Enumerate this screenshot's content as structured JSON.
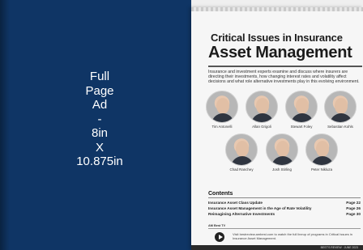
{
  "ad": {
    "lines": [
      "Full",
      "Page",
      "Ad",
      "-",
      "8in",
      "X",
      "10.875in"
    ]
  },
  "cover": {
    "title_line1": "Critical Issues in Insurance",
    "title_line2": "Asset Management",
    "intro": "Insurance and investment experts examine and discuss where insurers are directing their investments, how changing interest rates and volatility affect decisions and what role alternative investments play in this evolving environment.",
    "panelists": [
      {
        "name": "Tim Antonelli"
      },
      {
        "name": "Allan Grigoli"
      },
      {
        "name": "Stewart Foley"
      },
      {
        "name": "Sebastian Kohls"
      },
      {
        "name": "Chad Ranchey"
      },
      {
        "name": "Josh Stirling"
      },
      {
        "name": "Peter Nikluza"
      }
    ],
    "contents": {
      "heading": "Contents",
      "items": [
        {
          "title": "Insurance Asset Class Update",
          "page": "Page 22"
        },
        {
          "title": "Insurance Asset Management in the Age of Rate Volatility",
          "page": "Page 26"
        },
        {
          "title": "Reimagining Alternative Investments",
          "page": "Page 30"
        }
      ]
    },
    "tv": {
      "heading": "AM Best TV",
      "text": "Visit bestreview.ambest.com to watch the full lineup of programs in Critical Issues in Insurance Asset Management."
    },
    "footer": "BEST'S REVIEW · JUNE 2023"
  }
}
